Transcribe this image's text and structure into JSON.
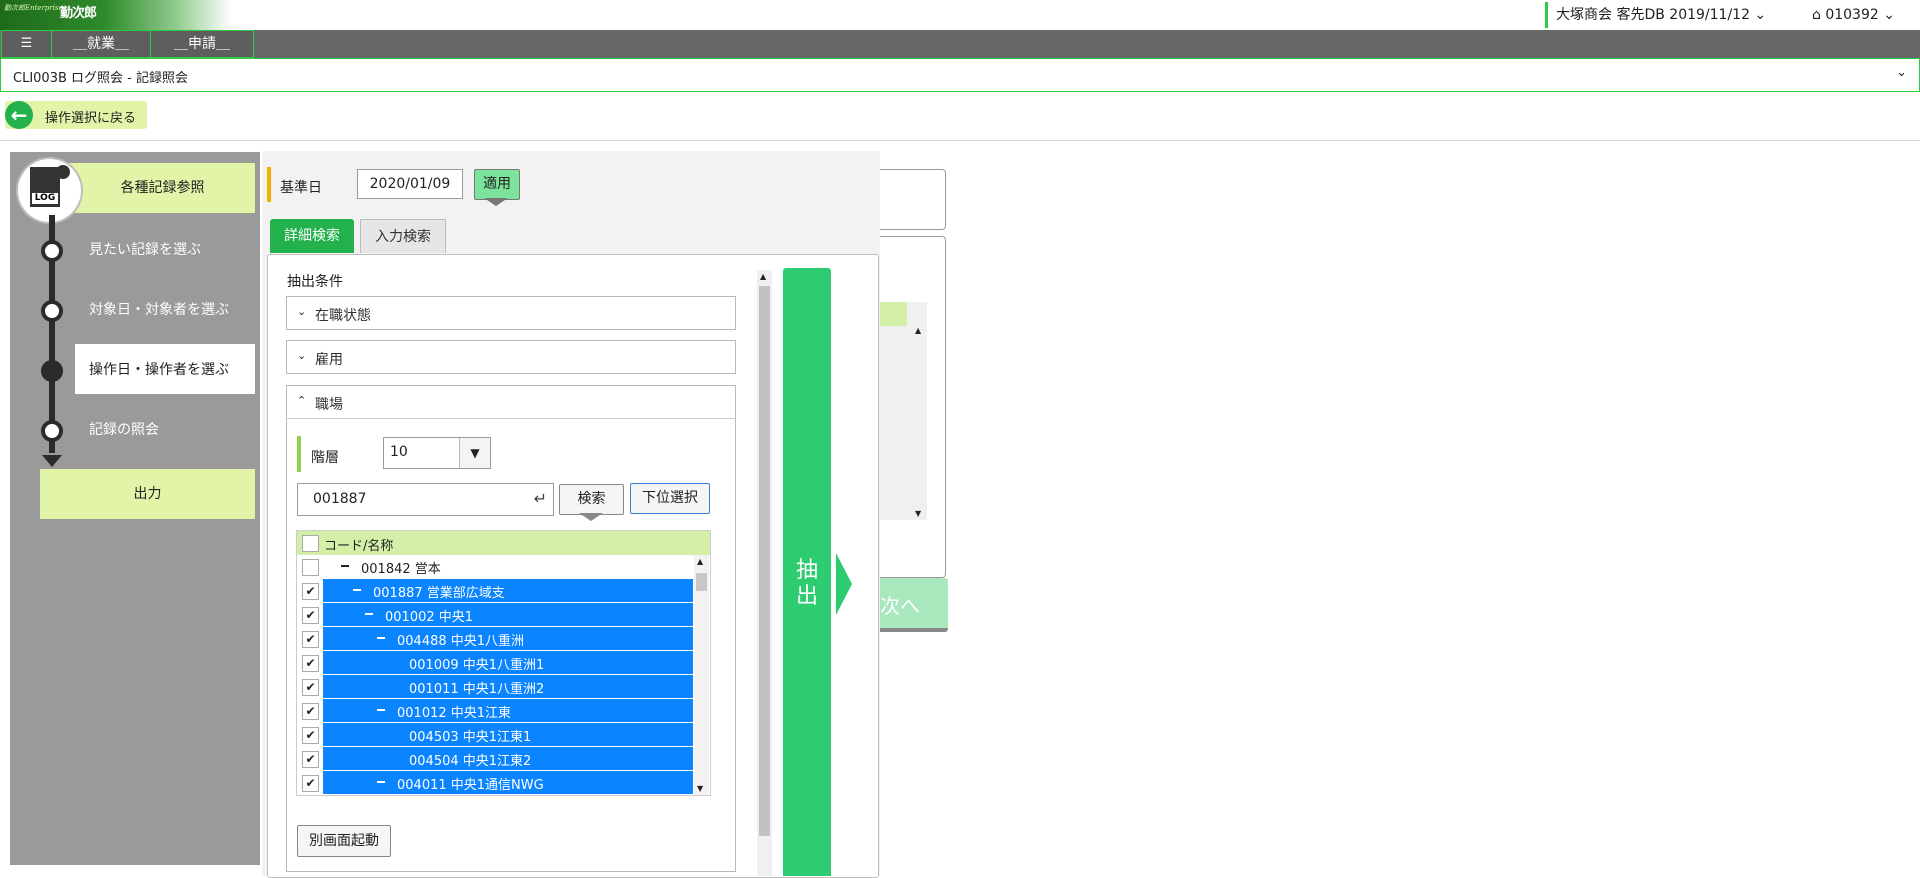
{
  "header": {
    "logo_small": "勤次郎Enterprise",
    "logo_main": "勤次郎",
    "company_db": "大塚商会 客先DB 2019/11/12 ⌄",
    "user_id": "⌂  010392  ⌄"
  },
  "menu": {
    "hamburger": "☰",
    "items": [
      "＿就業＿",
      "＿申請＿"
    ]
  },
  "screen": {
    "title": "CLI003B ログ照会 - 記録照会",
    "chevron": "⌄"
  },
  "back_button": {
    "label": "操作選択に戻る",
    "icon": "←"
  },
  "steps": {
    "header": "各種記録参照",
    "log_label": "LOG",
    "items": [
      "見たい記録を選ぶ",
      "対象日・対象者を選ぶ",
      "操作日・操作者を選ぶ",
      "記録の照会"
    ],
    "current_index": 2,
    "output": "出力"
  },
  "base_date": {
    "label": "基準日",
    "value": "2020/01/09",
    "apply": "適用"
  },
  "tabs": {
    "detail": "詳細検索",
    "input": "入力検索"
  },
  "conditions": {
    "title": "抽出条件",
    "accordions": [
      {
        "label": "在職状態",
        "chevron": "⌄"
      },
      {
        "label": "雇用",
        "chevron": "⌄"
      },
      {
        "label": "職場",
        "chevron": "⌃"
      }
    ]
  },
  "workplace": {
    "layer_label": "階層",
    "layer_value": "10",
    "code_value": "001887",
    "search": "検索",
    "sub_select": "下位選択",
    "tree_header": "コード/名称",
    "rows": [
      {
        "code": "001842",
        "name": "営本",
        "checked": false,
        "selected": false
      },
      {
        "code": "001887",
        "name": "営業部広域支",
        "checked": true,
        "selected": true
      },
      {
        "code": "001002",
        "name": "中央1",
        "checked": true,
        "selected": true
      },
      {
        "code": "004488",
        "name": "中央1八重洲",
        "checked": true,
        "selected": true
      },
      {
        "code": "001009",
        "name": "中央1八重洲1",
        "checked": true,
        "selected": true
      },
      {
        "code": "001011",
        "name": "中央1八重洲2",
        "checked": true,
        "selected": true
      },
      {
        "code": "001012",
        "name": "中央1江東",
        "checked": true,
        "selected": true
      },
      {
        "code": "004503",
        "name": "中央1江東1",
        "checked": true,
        "selected": true
      },
      {
        "code": "004504",
        "name": "中央1江東2",
        "checked": true,
        "selected": true
      },
      {
        "code": "004011",
        "name": "中央1通信NWG",
        "checked": true,
        "selected": true
      }
    ],
    "popup": "別画面起動"
  },
  "extract_button": "抽出",
  "next_button": "次へ",
  "colors": {
    "accent_green": "#2ecc71",
    "selection_blue": "#0a84ff",
    "step_highlight": "#e2f4a8"
  }
}
